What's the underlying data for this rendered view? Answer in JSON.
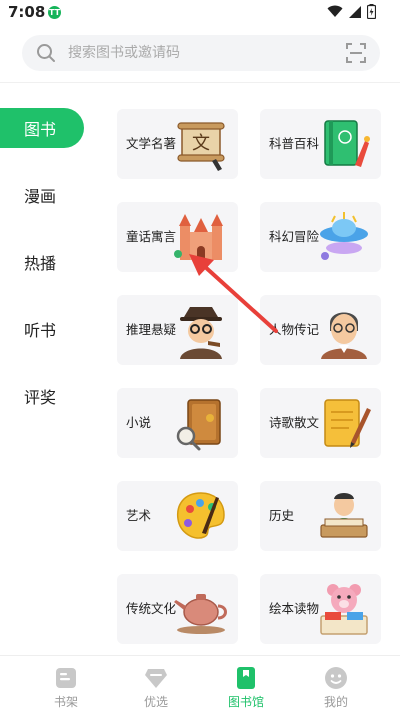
{
  "status_bar": {
    "time": "7:08",
    "app_badge": "TT"
  },
  "search": {
    "placeholder": "搜索图书或邀请码"
  },
  "sidebar": {
    "items": [
      {
        "label": "图书",
        "active": true
      },
      {
        "label": "漫画",
        "active": false
      },
      {
        "label": "热播",
        "active": false
      },
      {
        "label": "听书",
        "active": false
      },
      {
        "label": "评奖",
        "active": false
      }
    ]
  },
  "categories": [
    {
      "label": "文学名著",
      "icon": "scroll-icon"
    },
    {
      "label": "科普百科",
      "icon": "encyclopedia-icon"
    },
    {
      "label": "童话寓言",
      "icon": "castle-icon"
    },
    {
      "label": "科幻冒险",
      "icon": "ufo-icon"
    },
    {
      "label": "推理悬疑",
      "icon": "detective-icon"
    },
    {
      "label": "人物传记",
      "icon": "portrait-icon"
    },
    {
      "label": "小说",
      "icon": "book-magnifier-icon"
    },
    {
      "label": "诗歌散文",
      "icon": "notebook-pen-icon"
    },
    {
      "label": "艺术",
      "icon": "palette-icon"
    },
    {
      "label": "历史",
      "icon": "scholar-icon"
    },
    {
      "label": "传统文化",
      "icon": "teapot-icon"
    },
    {
      "label": "绘本读物",
      "icon": "teddy-bear-icon"
    }
  ],
  "bottom_nav": {
    "items": [
      {
        "label": "书架",
        "icon": "bookshelf-icon",
        "active": false
      },
      {
        "label": "优选",
        "icon": "diamond-icon",
        "active": false
      },
      {
        "label": "图书馆",
        "icon": "library-icon",
        "active": true
      },
      {
        "label": "我的",
        "icon": "profile-icon",
        "active": false
      }
    ]
  },
  "colors": {
    "accent": "#1fc16a",
    "card_bg": "#f5f5f7",
    "annotation_arrow": "#e8403a"
  }
}
